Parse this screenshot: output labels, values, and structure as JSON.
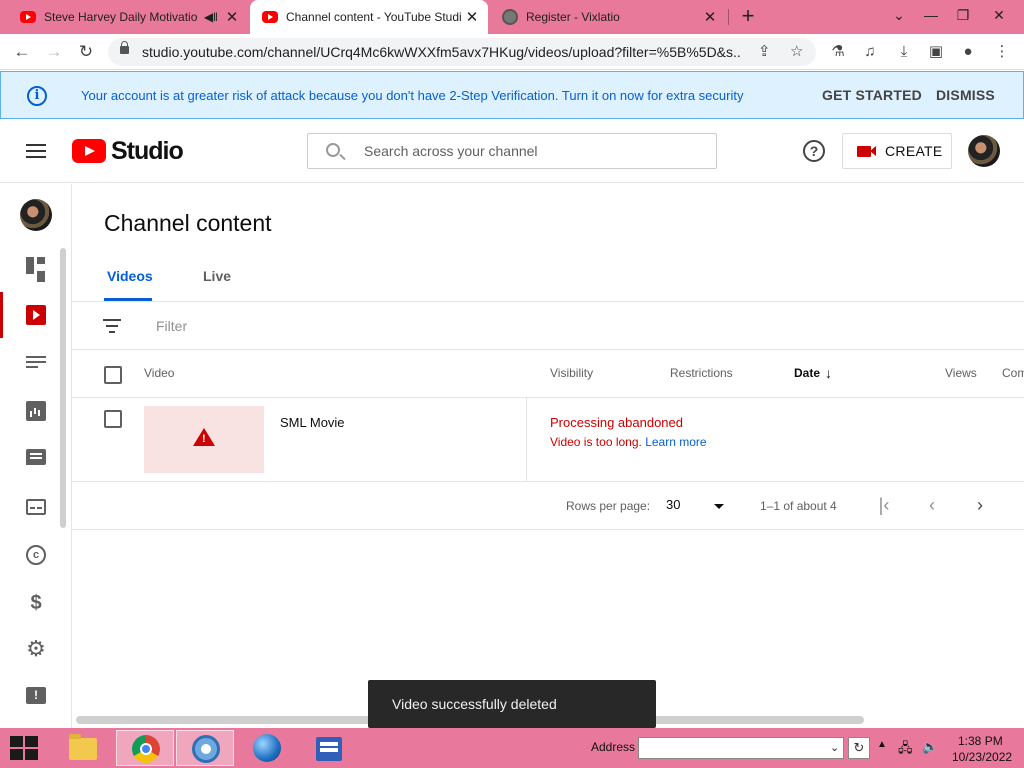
{
  "browser": {
    "tabs": [
      {
        "title": "Steve Harvey Daily Motivatio",
        "icon": "youtube-icon",
        "audio": true,
        "active": false
      },
      {
        "title": "Channel content - YouTube Studi",
        "icon": "youtube-icon",
        "active": true
      },
      {
        "title": "Register - Vixlatio",
        "icon": "globe-icon",
        "active": false
      }
    ],
    "url": "studio.youtube.com/channel/UCrq4Mc6kwWXXfm5avx7HKug/videos/upload?filter=%5B%5D&s..."
  },
  "banner": {
    "message": "Your account is at greater risk of attack because you don't have 2-Step Verification. Turn it on now for extra security",
    "get_started": "GET STARTED",
    "dismiss": "DISMISS",
    "color": "#065fd4"
  },
  "header": {
    "logo_text": "Studio",
    "search_placeholder": "Search across your channel",
    "help_glyph": "?",
    "create_label": "CREATE"
  },
  "page": {
    "title": "Channel content",
    "tabs": [
      {
        "label": "Videos",
        "active": true
      },
      {
        "label": "Live",
        "active": false
      }
    ],
    "filter_placeholder": "Filter"
  },
  "table": {
    "columns": {
      "video": "Video",
      "visibility": "Visibility",
      "restrictions": "Restrictions",
      "date": "Date",
      "views": "Views",
      "comments": "Com"
    },
    "rows": [
      {
        "title": "SML Movie",
        "status": "Processing abandoned",
        "reason": "Video is too long.",
        "link": "Learn more"
      }
    ]
  },
  "pager": {
    "rows_label": "Rows per page:",
    "rows_value": "30",
    "range": "1–1 of about 4"
  },
  "toast": {
    "message": "Video successfully deleted"
  },
  "taskbar": {
    "address_label": "Address",
    "time": "1:38 PM",
    "date": "10/23/2022"
  },
  "accent_color": "#cc0000"
}
